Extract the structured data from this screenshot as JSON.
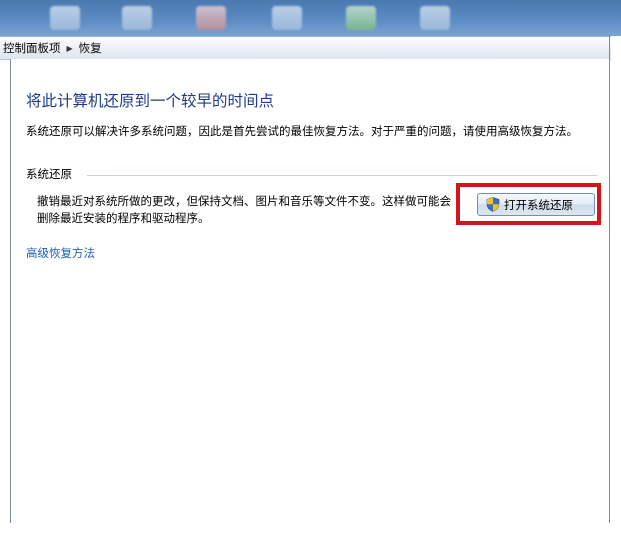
{
  "breadcrumb": {
    "items": [
      "控制面板项",
      "恢复"
    ],
    "separator": "▶"
  },
  "page": {
    "title": "将此计算机还原到一个较早的时间点",
    "intro": "系统还原可以解决许多系统问题，因此是首先尝试的最佳恢复方法。对于严重的问题，请使用高级恢复方法。"
  },
  "system_restore": {
    "heading": "系统还原",
    "description": "撤销最近对系统所做的更改，但保持文档、图片和音乐等文件不变。这样做可能会删除最近安装的程序和驱动程序。",
    "button_label": "打开系统还原",
    "button_icon": "uac-shield-icon"
  },
  "advanced_link": "高级恢复方法",
  "colors": {
    "title": "#1e3a8a",
    "link": "#1e5fb0",
    "highlight": "#d3141b"
  }
}
